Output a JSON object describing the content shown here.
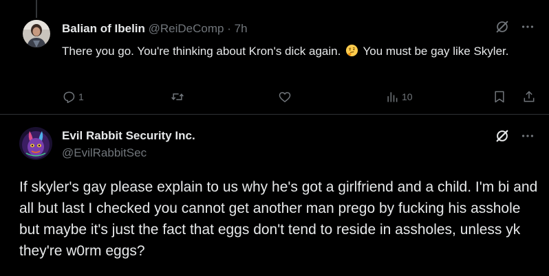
{
  "reply_tweet": {
    "author_name": "Balian of Ibelin",
    "author_handle": "@ReiDeComp",
    "separator": "·",
    "time": "7h",
    "text_before_emoji": "There you go. You're thinking about Kron's dick again.",
    "emoji": "thinking-face",
    "text_after_emoji": "You must be gay like Skyler.",
    "replies_count": "1",
    "views_count": "10"
  },
  "main_tweet": {
    "author_name": "Evil Rabbit Security Inc.",
    "author_handle": "@EvilRabbitSec",
    "text": "If skyler's gay please explain to us why he's got a girlfriend and a child. I'm bi and all but last I checked you cannot get another man prego by fucking his asshole but maybe it's just the fact that eggs don't tend to reside in assholes, unless yk they're w0rm eggs?"
  },
  "icons": [
    "grok-icon",
    "more-icon",
    "reply-icon",
    "retweet-icon",
    "like-icon",
    "views-icon",
    "bookmark-icon",
    "share-icon"
  ],
  "colors": {
    "background": "#000000",
    "primary_text": "#e7e9ea",
    "secondary_text": "#71767b",
    "divider": "#2f3336"
  }
}
